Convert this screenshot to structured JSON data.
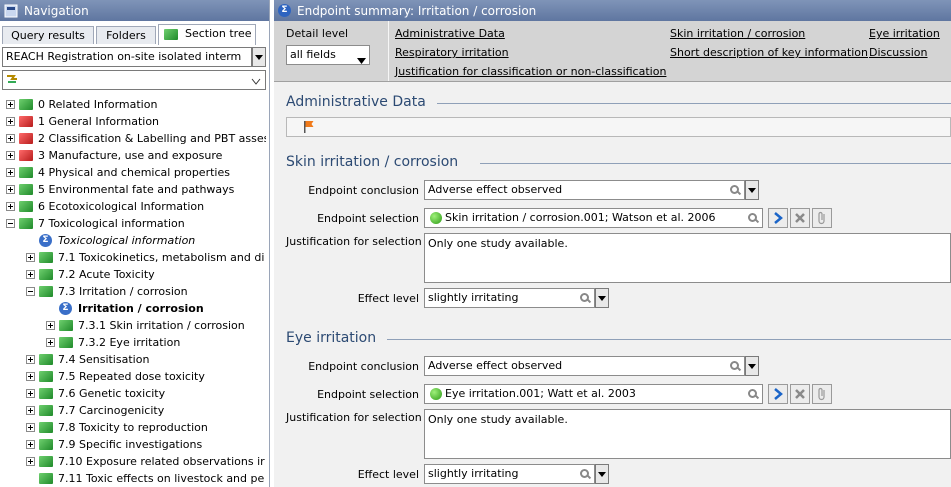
{
  "navigation": {
    "title": "Navigation",
    "tabs": [
      "Query results",
      "Folders",
      "Section tree"
    ],
    "active_tab": "Section tree",
    "registration_select": "REACH Registration on-site isolated interm",
    "tree": [
      {
        "label": "0 Related Information",
        "level": 0,
        "expander": "plus",
        "icon": "book-green"
      },
      {
        "label": "1 General Information",
        "level": 0,
        "expander": "plus",
        "icon": "book-red"
      },
      {
        "label": "2 Classification & Labelling and PBT asses",
        "level": 0,
        "expander": "plus",
        "icon": "book-red"
      },
      {
        "label": "3 Manufacture, use and exposure",
        "level": 0,
        "expander": "plus",
        "icon": "book-red"
      },
      {
        "label": "4 Physical and chemical properties",
        "level": 0,
        "expander": "plus",
        "icon": "book-green"
      },
      {
        "label": "5 Environmental fate and pathways",
        "level": 0,
        "expander": "plus",
        "icon": "book-green"
      },
      {
        "label": "6 Ecotoxicological Information",
        "level": 0,
        "expander": "plus",
        "icon": "book-green"
      },
      {
        "label": "7 Toxicological information",
        "level": 0,
        "expander": "minus",
        "icon": "book-green"
      },
      {
        "label": "Toxicological information",
        "level": 1,
        "expander": "none",
        "icon": "sigma",
        "style": "italic"
      },
      {
        "label": "7.1 Toxicokinetics, metabolism and di",
        "level": 1,
        "expander": "plus",
        "icon": "book-green"
      },
      {
        "label": "7.2 Acute Toxicity",
        "level": 1,
        "expander": "plus",
        "icon": "book-green"
      },
      {
        "label": "7.3 Irritation / corrosion",
        "level": 1,
        "expander": "minus",
        "icon": "book-green"
      },
      {
        "label": "Irritation / corrosion",
        "level": 2,
        "expander": "none",
        "icon": "sigma",
        "style": "bold"
      },
      {
        "label": "7.3.1 Skin irritation / corrosion",
        "level": 2,
        "expander": "plus",
        "icon": "book-green"
      },
      {
        "label": "7.3.2 Eye irritation",
        "level": 2,
        "expander": "plus",
        "icon": "book-green"
      },
      {
        "label": "7.4 Sensitisation",
        "level": 1,
        "expander": "plus",
        "icon": "book-green"
      },
      {
        "label": "7.5 Repeated dose toxicity",
        "level": 1,
        "expander": "plus",
        "icon": "book-green"
      },
      {
        "label": "7.6 Genetic toxicity",
        "level": 1,
        "expander": "plus",
        "icon": "book-green"
      },
      {
        "label": "7.7 Carcinogenicity",
        "level": 1,
        "expander": "plus",
        "icon": "book-green"
      },
      {
        "label": "7.8 Toxicity to reproduction",
        "level": 1,
        "expander": "plus",
        "icon": "book-green"
      },
      {
        "label": "7.9 Specific investigations",
        "level": 1,
        "expander": "plus",
        "icon": "book-green"
      },
      {
        "label": "7.10 Exposure related observations ir",
        "level": 1,
        "expander": "plus",
        "icon": "book-green"
      },
      {
        "label": "7.11 Toxic effects on livestock and pe",
        "level": 1,
        "expander": "none",
        "icon": "book-green"
      }
    ]
  },
  "editor": {
    "title": "Endpoint summary: Irritation / corrosion",
    "detail_level_label": "Detail level",
    "detail_level_value": "all fields",
    "nav_links": {
      "administrative_data": "Administrative Data",
      "respiratory_irritation": "Respiratory irritation",
      "justification": "Justification for classification or non-classification",
      "skin_irritation": "Skin irritation / corrosion",
      "short_description": "Short description of key information",
      "eye_irritation": "Eye irritation",
      "discussion": "Discussion"
    },
    "administrative": {
      "heading": "Administrative Data"
    },
    "skin": {
      "heading": "Skin irritation / corrosion",
      "conclusion_label": "Endpoint conclusion",
      "conclusion_value": "Adverse effect observed",
      "selection_label": "Endpoint selection",
      "selection_value": "Skin irritation / corrosion.001; Watson et al. 2006",
      "justification_label": "Justification for selection",
      "justification_value": "Only one study available.",
      "effect_label": "Effect level",
      "effect_value": "slightly irritating"
    },
    "eye": {
      "heading": "Eye irritation",
      "conclusion_label": "Endpoint conclusion",
      "conclusion_value": "Adverse effect observed",
      "selection_label": "Endpoint selection",
      "selection_value": "Eye irritation.001; Watt et al. 2003",
      "justification_label": "Justification for selection",
      "justification_value": "Only one study available.",
      "effect_label": "Effect level",
      "effect_value": "slightly irritating"
    }
  },
  "colors": {
    "titlebar": "#6b80a8",
    "section_heading": "#2c4a73",
    "toolbar_bg": "#d4d4d4",
    "content_bg": "#f1f1f1"
  }
}
